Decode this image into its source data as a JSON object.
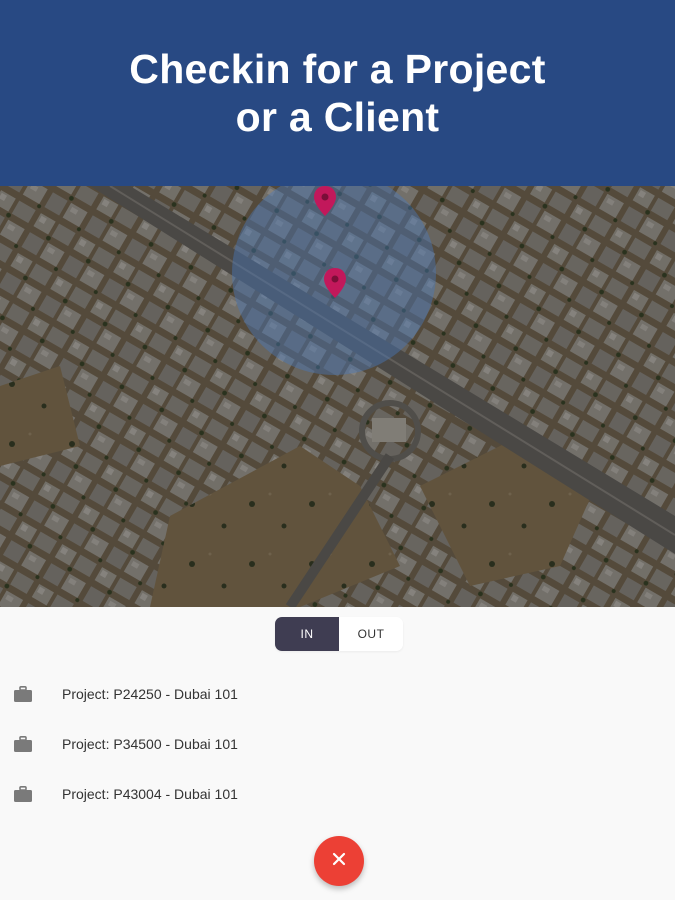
{
  "banner": {
    "title_line1": "Checkin for a Project",
    "title_line2": "or a Client"
  },
  "map": {
    "pin_color": "#c2185b",
    "radius_fill_color": "#4a78b8"
  },
  "toggle": {
    "in_label": "IN",
    "out_label": "OUT",
    "selected": "IN",
    "active_color": "#3f3d52"
  },
  "projects": [
    {
      "label": "Project: P24250 - Dubai 101",
      "icon": "briefcase-icon"
    },
    {
      "label": "Project: P34500 - Dubai 101",
      "icon": "briefcase-icon"
    },
    {
      "label": "Project: P43004 - Dubai 101",
      "icon": "briefcase-icon"
    }
  ],
  "fab": {
    "icon": "close-icon",
    "color": "#ec4035"
  }
}
